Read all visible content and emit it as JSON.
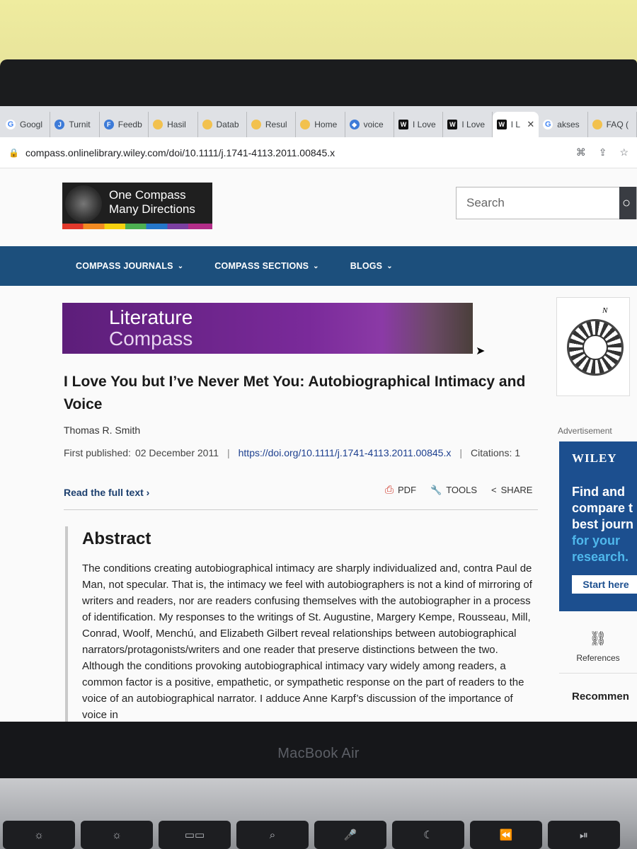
{
  "device": {
    "brand": "MacBook Air",
    "keys": [
      "☼",
      "☼",
      "▭▭",
      "⌕",
      "🎤",
      "☾",
      "⏪",
      "⏯"
    ]
  },
  "browser": {
    "tabs": [
      {
        "label": "Googl",
        "icon": "google-scholar-icon"
      },
      {
        "label": "Turnit",
        "icon": "turnitin-icon"
      },
      {
        "label": "Feedb",
        "icon": "feedback-icon"
      },
      {
        "label": "Hasil",
        "icon": "yellow-site-icon"
      },
      {
        "label": "Datab",
        "icon": "yellow-site-icon"
      },
      {
        "label": "Resul",
        "icon": "yellow-site-icon"
      },
      {
        "label": "Home",
        "icon": "yellow-site-icon"
      },
      {
        "label": "voice",
        "icon": "blue-diamond-icon"
      },
      {
        "label": "I Love",
        "icon": "wiley-w-icon"
      },
      {
        "label": "I Love",
        "icon": "wiley-w-icon"
      },
      {
        "label": "I L",
        "icon": "wiley-w-icon"
      },
      {
        "label": "akses",
        "icon": "google-g-icon"
      },
      {
        "label": "FAQ (",
        "icon": "yellow-site-icon"
      }
    ],
    "url": "compass.onlinelibrary.wiley.com/doi/10.1111/j.1741-4113.2011.00845.x"
  },
  "header": {
    "logo_line1": "One Compass",
    "logo_line2": "Many Directions",
    "search_placeholder": "Search"
  },
  "nav": {
    "items": [
      "COMPASS JOURNALS",
      "COMPASS SECTIONS",
      "BLOGS"
    ]
  },
  "journal": {
    "banner_line1": "Literature",
    "banner_line2": "Compass"
  },
  "article": {
    "title": "I Love You but I’ve Never Met You: Autobiographical Intimacy and Voice",
    "author": "Thomas R. Smith",
    "published_label": "First published:",
    "published_date": "02 December 2011",
    "doi": "https://doi.org/10.1111/j.1741-4113.2011.00845.x",
    "citations": "Citations: 1",
    "read_full": "Read the full text",
    "tools": {
      "pdf": "PDF",
      "tools": "TOOLS",
      "share": "SHARE"
    },
    "abstract_heading": "Abstract",
    "abstract_text": "The conditions creating autobiographical intimacy are sharply individualized and, contra Paul de Man, not specular. That is, the intimacy we feel with autobiographers is not a kind of mirroring of writers and readers, nor are readers confusing themselves with the autobiographer in a process of identification. My responses to the writings of St. Augustine, Margery Kempe, Rousseau, Mill, Conrad, Woolf, Menchú, and Elizabeth Gilbert reveal relationships between autobiographical narrators/protagonists/writers and one reader that preserve distinctions between the two. Although the conditions provoking autobiographical intimacy vary widely among readers, a common factor is a positive, empathetic, or sympathetic response on the part of readers to the voice of an autobiographical narrator. I adduce Anne Karpf’s discussion of the importance of voice in"
  },
  "sidebar": {
    "ad_label": "Advertisement",
    "ad_brand": "WILEY",
    "ad_line1": "Find and",
    "ad_line2": "compare t",
    "ad_line3": "best journ",
    "ad_line4": "for your",
    "ad_line5": "research.",
    "ad_button": "Start here",
    "references": "References",
    "recommended": "Recommen"
  },
  "colors": {
    "nav_bg": "#1c4f7c",
    "banner_purple": "#7a2a9a",
    "ad_blue": "#1c4f8f",
    "ad_accent": "#4fb8ec"
  }
}
